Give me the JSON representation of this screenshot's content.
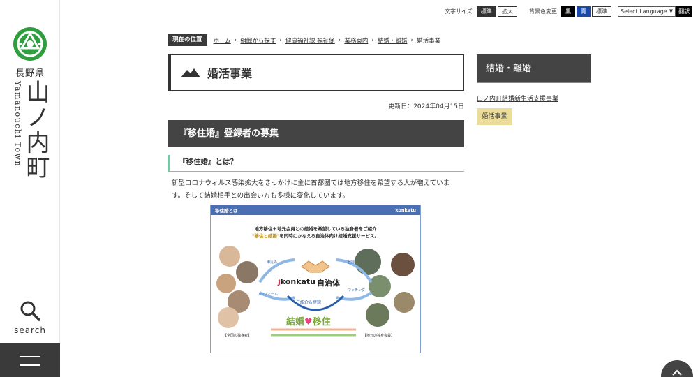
{
  "sidebar": {
    "prefecture": "長野県",
    "town_kanji": "山ノ内町",
    "town_romaji": "Yamanouchi Town",
    "search_label": "search"
  },
  "utility": {
    "font_size_label": "文字サイズ",
    "font_standard": "標準",
    "font_large": "拡大",
    "bg_color_label": "背景色変更",
    "bg_black": "黒",
    "bg_blue": "青",
    "bg_standard": "標準",
    "language_select": "Select Language",
    "translate": "翻訳"
  },
  "breadcrumb": {
    "label": "現在の位置",
    "items": [
      "ホーム",
      "組織から探す",
      "健康福祉課 福祉係",
      "業務案内",
      "結婚・離婚"
    ],
    "current": "婚活事業"
  },
  "page": {
    "title": "婚活事業",
    "updated": "更新日：2024年04月15日",
    "h2": "『移住婚』登録者の募集",
    "h3": "『移住婚』とは？",
    "body": "新型コロナウィルス感染拡大をきっかけに主に首都圏では地方移住を希望する人が増えています。そして結婚相手との出会い方も多様に変化しています。"
  },
  "infographic": {
    "header_title": "移住婚とは",
    "header_brand": "konkatu",
    "line1": "地方移住＋地元会員との結婚を希望している独身者をご紹介",
    "line2_highlight": "\"移住と結婚\"",
    "line2_rest": "を同時にかなえる自治体向け結婚支援サービス。",
    "brand_j": "j",
    "brand_name": "konkatu",
    "jichitai": "自治体",
    "intro": "ご紹介＆登録",
    "kekkon": "結婚",
    "iju": "移住",
    "heart": "♥",
    "cap_left": "【全国の独身者】",
    "cap_right": "【地元の独身会員】",
    "arrow_apply": "申込み",
    "arrow_profile": "プロフィール",
    "arrow_register": "登録",
    "arrow_match": "マッチング"
  },
  "side": {
    "heading": "結婚・離婚",
    "link": "山ノ内町結婚新生活支援事業",
    "active": "婚活事業"
  },
  "colors": {
    "dark": "#444444",
    "accent_green": "#7cc6a6",
    "active_yellow": "#ecdc9a",
    "logo_green": "#2e9e3e"
  }
}
